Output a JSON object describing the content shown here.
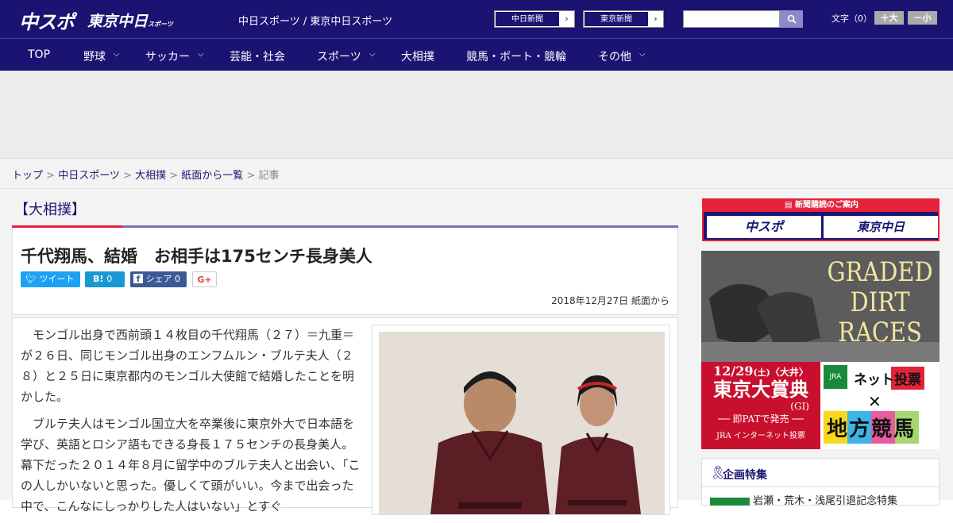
{
  "header": {
    "logo_chunichi": "中スポ",
    "logo_tokyo": "東京中日",
    "logo_tokyo_small": "スポーツ",
    "site_title": "中日スポーツ / 東京中日スポーツ",
    "paper_links": [
      {
        "label": "中日新聞"
      },
      {
        "label": "東京新聞"
      }
    ],
    "search_placeholder": "",
    "font_size_label": "文字（0）",
    "font_up": "＋大",
    "font_down": "－小"
  },
  "nav": {
    "items": [
      {
        "label": "TOP",
        "has_menu": false
      },
      {
        "label": "野球",
        "has_menu": true
      },
      {
        "label": "サッカー",
        "has_menu": true
      },
      {
        "label": "芸能・社会",
        "has_menu": false
      },
      {
        "label": "スポーツ",
        "has_menu": true
      },
      {
        "label": "大相撲",
        "has_menu": false
      },
      {
        "label": "競馬・ボート・競輪",
        "has_menu": false
      },
      {
        "label": "その他",
        "has_menu": true
      }
    ]
  },
  "breadcrumb": {
    "items": [
      "トップ",
      "中日スポーツ",
      "大相撲",
      "紙面から一覧"
    ],
    "current": "記事",
    "separator": ">"
  },
  "article": {
    "category": "【大相撲】",
    "title": "千代翔馬、結婚　お相手は175センチ長身美人",
    "share": {
      "tweet": "ツイート",
      "hatena": "B!",
      "hatena_count": "0",
      "facebook": "シェア",
      "facebook_count": "0",
      "gplus": "G+"
    },
    "date": "2018年12月27日 紙面から",
    "paragraphs": [
      "モンゴル出身で西前頭１４枚目の千代翔馬（２７）＝九重＝が２６日、同じモンゴル出身のエンフムルン・ブルテ夫人（２８）と２５日に東京都内のモンゴル大使館で結婚したことを明かした。",
      "ブルテ夫人はモンゴル国立大を卒業後に東京外大で日本語を学び、英語とロシア語もできる身長１７５センチの長身美人。幕下だった２０１４年８月に留学中のブルテ夫人と出会い、「この人しかいないと思った。優しくて頭がいい。今まで出会った中で、こんなにしっかりした人はいない」とすぐ"
    ]
  },
  "sidebar": {
    "subscribe_label": "新聞購読のご案内",
    "subscribe_chunichi": "中スポ",
    "subscribe_tokyo": "東京中日",
    "banner": {
      "line1": "GRADED",
      "line2": "DIRT",
      "line3": "RACES",
      "date": "12/29",
      "day": "(土)",
      "venue": "〈大井〉",
      "race": "東京大賞典",
      "grade": "(GI)",
      "sale": "── 即PATで発売 ──",
      "jra": "JRA",
      "jra_net": "インターネット投票",
      "net": "ネット投票",
      "local": "地方競馬"
    },
    "feature_title": "企画特集",
    "feature_item": "岩瀬・荒木・浅尾引退記念特集"
  },
  "colors": {
    "brand_navy": "#1a1372",
    "accent_red": "#e4233a",
    "nav_purple": "#7670b8"
  }
}
